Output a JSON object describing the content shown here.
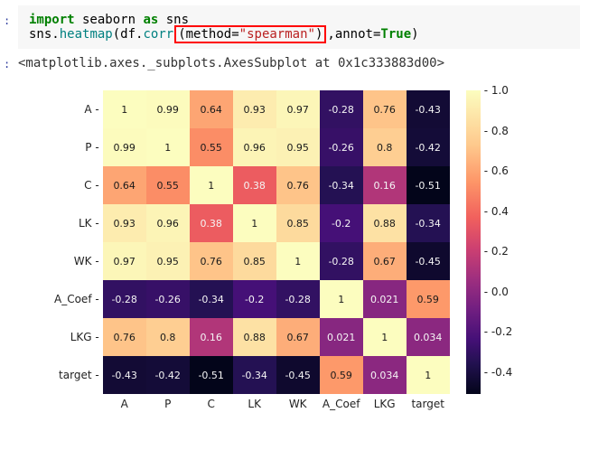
{
  "code": {
    "kw_import": "import",
    "seaborn": " seaborn ",
    "kw_as": "as",
    "sns": " sns",
    "line2a": "sns",
    "dot1": ".",
    "heatmap": "heatmap",
    "paren_open": "(df",
    "dot2": ".",
    "corr": "corr",
    "box_open": "(method",
    "eq1": "=",
    "str_spearman": "\"spearman\"",
    "box_close": ")",
    "comma": ",",
    "annot": "annot",
    "eq2": "=",
    "true": "True",
    "close": ")"
  },
  "output_line": "<matplotlib.axes._subplots.AxesSubplot at 0x1c333883d00>",
  "chart_data": {
    "type": "heatmap",
    "title": "",
    "categories": [
      "A",
      "P",
      "C",
      "LK",
      "WK",
      "A_Coef",
      "LKG",
      "target"
    ],
    "matrix": [
      [
        1,
        0.99,
        0.64,
        0.93,
        0.97,
        -0.28,
        0.76,
        -0.43
      ],
      [
        0.99,
        1,
        0.55,
        0.96,
        0.95,
        -0.26,
        0.8,
        -0.42
      ],
      [
        0.64,
        0.55,
        1,
        0.38,
        0.76,
        -0.34,
        0.16,
        -0.51
      ],
      [
        0.93,
        0.96,
        0.38,
        1,
        0.85,
        -0.2,
        0.88,
        -0.34
      ],
      [
        0.97,
        0.95,
        0.76,
        0.85,
        1,
        -0.28,
        0.67,
        -0.45
      ],
      [
        -0.28,
        -0.26,
        -0.34,
        -0.2,
        -0.28,
        1,
        0.021,
        0.59
      ],
      [
        0.76,
        0.8,
        0.16,
        0.88,
        0.67,
        0.021,
        1,
        0.034
      ],
      [
        -0.43,
        -0.42,
        -0.51,
        -0.34,
        -0.45,
        0.59,
        0.034,
        1
      ]
    ],
    "vmin": -0.51,
    "vmax": 1.0,
    "colorbar_ticks": [
      -0.4,
      -0.2,
      0.0,
      0.2,
      0.4,
      0.6,
      0.8,
      1.0
    ],
    "colormap_stops": [
      [
        -0.51,
        "#03051A"
      ],
      [
        -0.35,
        "#221150"
      ],
      [
        -0.2,
        "#451077"
      ],
      [
        -0.05,
        "#721F81"
      ],
      [
        0.1,
        "#9F2F7F"
      ],
      [
        0.25,
        "#CD4071"
      ],
      [
        0.4,
        "#F1605D"
      ],
      [
        0.58,
        "#FD9668"
      ],
      [
        0.78,
        "#FEC98D"
      ],
      [
        1.0,
        "#FCFDBF"
      ]
    ]
  }
}
